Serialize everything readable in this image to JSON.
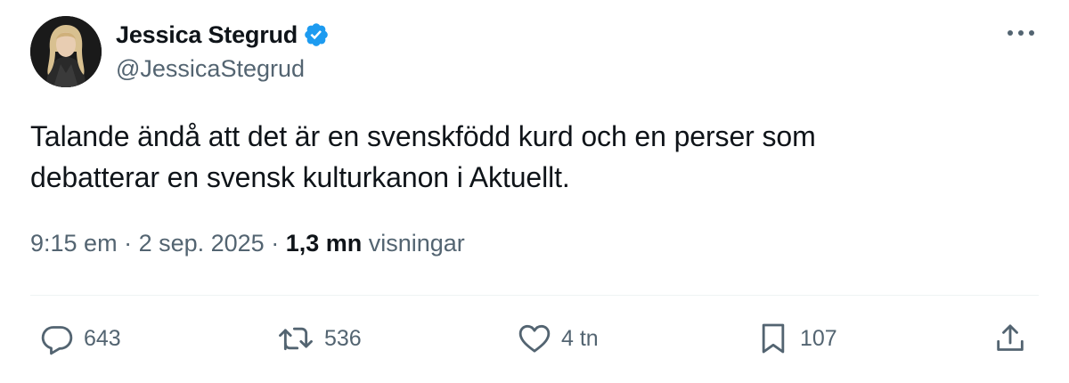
{
  "author": {
    "display_name": "Jessica Stegrud",
    "handle": "@JessicaStegrud",
    "verified_color": "#1d9bf0"
  },
  "tweet": {
    "text_line1": "Talande ändå att det är en svenskfödd kurd och en perser som",
    "text_line2": "debatterar en svensk kulturkanon i Aktuellt."
  },
  "meta": {
    "time": "9:15 em",
    "separator": " · ",
    "date": "2 sep. 2025",
    "views_count": "1,3 mn",
    "views_label": " visningar"
  },
  "actions": {
    "replies": "643",
    "reposts": "536",
    "likes": "4 tn",
    "bookmarks": "107"
  },
  "icons": {
    "more": "more-icon",
    "reply": "reply-icon",
    "repost": "repost-icon",
    "like": "heart-icon",
    "bookmark": "bookmark-icon",
    "share": "share-icon"
  }
}
